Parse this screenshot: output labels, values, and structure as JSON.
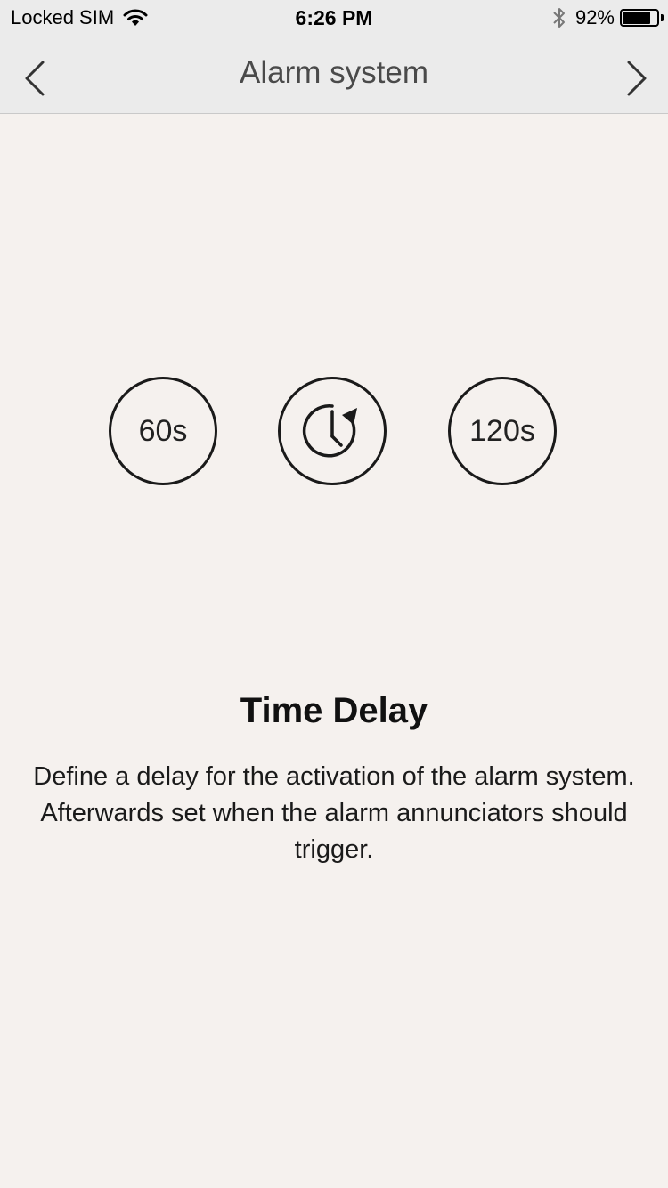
{
  "status_bar": {
    "carrier": "Locked SIM",
    "time": "6:26 PM",
    "battery_percent_text": "92%",
    "battery_level": 0.92
  },
  "nav": {
    "title": "Alarm system"
  },
  "delay_options": {
    "short_label": "60s",
    "long_label": "120s"
  },
  "content": {
    "heading": "Time Delay",
    "description": "Define a delay for the activation of the alarm system. Afterwards set when the alarm annunciators should trigger."
  },
  "icons": {
    "back": "chevron-left-icon",
    "forward": "chevron-right-icon",
    "timer": "timer-reset-icon",
    "wifi": "wifi-icon",
    "bluetooth": "bluetooth-icon",
    "battery": "battery-icon"
  }
}
